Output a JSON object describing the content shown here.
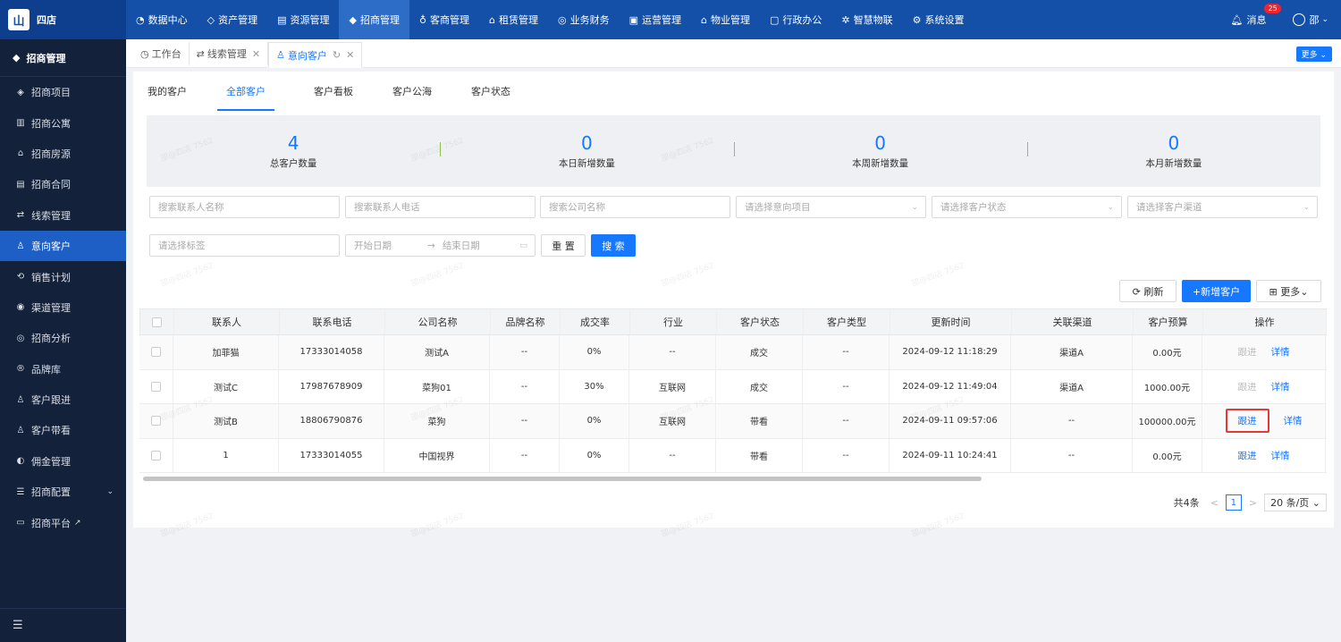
{
  "topbar": {
    "logo_glyph": "山",
    "logo_text": "四店",
    "nav": [
      {
        "icon": "◔",
        "label": "数据中心"
      },
      {
        "icon": "◇",
        "label": "资产管理"
      },
      {
        "icon": "▤",
        "label": "资源管理"
      },
      {
        "icon": "◆",
        "label": "招商管理"
      },
      {
        "icon": "♁",
        "label": "客商管理"
      },
      {
        "icon": "⌂",
        "label": "租赁管理"
      },
      {
        "icon": "◎",
        "label": "业务财务"
      },
      {
        "icon": "▣",
        "label": "运营管理"
      },
      {
        "icon": "⌂",
        "label": "物业管理"
      },
      {
        "icon": "▢",
        "label": "行政办公"
      },
      {
        "icon": "✲",
        "label": "智慧物联"
      },
      {
        "icon": "⚙",
        "label": "系统设置"
      }
    ],
    "message_label": "消息",
    "message_count": "25",
    "user_name": "邵"
  },
  "sidebar": {
    "title": "招商管理",
    "items": [
      {
        "icon": "◈",
        "label": "招商项目"
      },
      {
        "icon": "▥",
        "label": "招商公寓"
      },
      {
        "icon": "⌂",
        "label": "招商房源"
      },
      {
        "icon": "▤",
        "label": "招商合同"
      },
      {
        "icon": "⇄",
        "label": "线索管理"
      },
      {
        "icon": "♙",
        "label": "意向客户"
      },
      {
        "icon": "⟲",
        "label": "销售计划"
      },
      {
        "icon": "◉",
        "label": "渠道管理"
      },
      {
        "icon": "◎",
        "label": "招商分析"
      },
      {
        "icon": "®",
        "label": "品牌库"
      },
      {
        "icon": "♙",
        "label": "客户跟进"
      },
      {
        "icon": "♙",
        "label": "客户带看"
      },
      {
        "icon": "◐",
        "label": "佣金管理"
      },
      {
        "icon": "☰",
        "label": "招商配置"
      },
      {
        "icon": "▭",
        "label": "招商平台"
      }
    ],
    "config_chevron": "⌄",
    "platform_ext": "↗",
    "bottom_icon": "☰"
  },
  "tabs": [
    {
      "icon": "◷",
      "label": "工作台"
    },
    {
      "icon": "⇄",
      "label": "线索管理",
      "close": "✕"
    },
    {
      "icon": "♙",
      "label": "意向客户",
      "refresh": "↻",
      "close": "✕"
    }
  ],
  "more_label": "更多 ⌄",
  "subtabs": [
    "我的客户",
    "全部客户",
    "客户看板",
    "客户公海",
    "客户状态"
  ],
  "stats": [
    {
      "value": "4",
      "label": "总客户数量"
    },
    {
      "value": "0",
      "label": "本日新增数量"
    },
    {
      "value": "0",
      "label": "本周新增数量"
    },
    {
      "value": "0",
      "label": "本月新增数量"
    }
  ],
  "filters": {
    "contact_name": "搜索联系人名称",
    "contact_phone": "搜索联系人电话",
    "company_name": "搜索公司名称",
    "project": "请选择意向项目",
    "status": "请选择客户状态",
    "channel": "请选择客户渠道",
    "tag": "请选择标签",
    "start_date": "开始日期",
    "date_sep": "→",
    "end_date": "结束日期",
    "reset": "重 置",
    "search": "搜 索"
  },
  "toolbar": {
    "refresh": "⟳  刷新",
    "add": "+新增客户",
    "more": "⊞  更多⌄"
  },
  "table": {
    "headers": [
      "联系人",
      "联系电话",
      "公司名称",
      "品牌名称",
      "成交率",
      "行业",
      "客户状态",
      "客户类型",
      "更新时间",
      "关联渠道",
      "客户预算",
      "操作"
    ],
    "rows": [
      [
        "加菲猫",
        "17333014058",
        "测试A",
        "--",
        "0%",
        "--",
        "成交",
        "--",
        "2024-09-12 11:18:29",
        "渠道A",
        "0.00元"
      ],
      [
        "测试C",
        "17987678909",
        "菜狗01",
        "--",
        "30%",
        "互联网",
        "成交",
        "--",
        "2024-09-12 11:49:04",
        "渠道A",
        "1000.00元"
      ],
      [
        "测试B",
        "18806790876",
        "菜狗",
        "--",
        "0%",
        "互联网",
        "带看",
        "--",
        "2024-09-11 09:57:06",
        "--",
        "100000.00元"
      ],
      [
        "1",
        "17333014055",
        "中国视界",
        "--",
        "0%",
        "--",
        "带看",
        "--",
        "2024-09-11 10:24:41",
        "--",
        "0.00元"
      ]
    ],
    "follow_label": "跟进",
    "detail_label": "详情"
  },
  "pagination": {
    "total": "共4条",
    "prev": "<",
    "page": "1",
    "next": ">",
    "size": "20 条/页 ⌄"
  },
  "watermark": "邵@四店 7562"
}
